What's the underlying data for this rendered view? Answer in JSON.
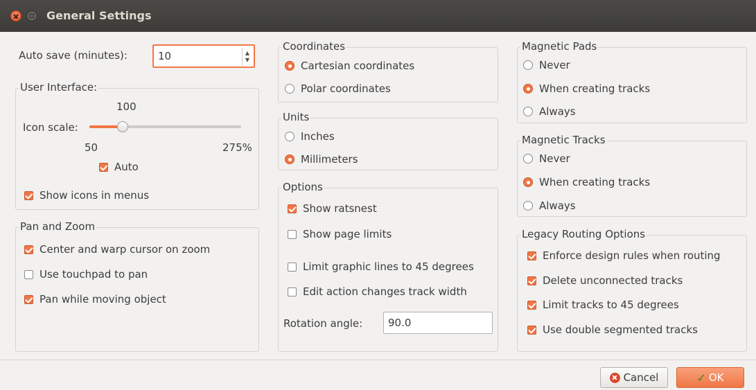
{
  "window": {
    "title": "General Settings"
  },
  "autosave": {
    "label": "Auto save (minutes):",
    "value": "10"
  },
  "user_interface": {
    "title": "User Interface:",
    "icon_scale_label": "Icon scale:",
    "icon_scale_value": "100",
    "slider_min": "50",
    "slider_max": "275%",
    "slider_fraction": 0.22,
    "auto": {
      "label": "Auto",
      "checked": true
    },
    "show_icons": {
      "label": "Show icons in menus",
      "checked": true
    }
  },
  "pan_zoom": {
    "title": "Pan and Zoom",
    "items": [
      {
        "label": "Center and warp cursor on zoom",
        "checked": true
      },
      {
        "label": "Use touchpad to pan",
        "checked": false
      },
      {
        "label": "Pan while moving object",
        "checked": true
      }
    ]
  },
  "coordinates": {
    "title": "Coordinates",
    "options": [
      {
        "label": "Cartesian coordinates",
        "selected": true
      },
      {
        "label": "Polar coordinates",
        "selected": false
      }
    ]
  },
  "units": {
    "title": "Units",
    "options": [
      {
        "label": "Inches",
        "selected": false
      },
      {
        "label": "Millimeters",
        "selected": true
      }
    ]
  },
  "options": {
    "title": "Options",
    "items": [
      {
        "label": "Show ratsnest",
        "checked": true
      },
      {
        "label": "Show page limits",
        "checked": false
      },
      {
        "label": "Limit graphic lines to 45 degrees",
        "checked": false
      },
      {
        "label": "Edit action changes track width",
        "checked": false
      }
    ],
    "rotation_label": "Rotation angle:",
    "rotation_value": "90.0"
  },
  "magnetic_pads": {
    "title": "Magnetic Pads",
    "options": [
      {
        "label": "Never",
        "selected": false
      },
      {
        "label": "When creating tracks",
        "selected": true
      },
      {
        "label": "Always",
        "selected": false
      }
    ]
  },
  "magnetic_tracks": {
    "title": "Magnetic Tracks",
    "options": [
      {
        "label": "Never",
        "selected": false
      },
      {
        "label": "When creating tracks",
        "selected": true
      },
      {
        "label": "Always",
        "selected": false
      }
    ]
  },
  "legacy_routing": {
    "title": "Legacy Routing Options",
    "items": [
      {
        "label": "Enforce design rules when routing",
        "checked": true
      },
      {
        "label": "Delete unconnected tracks",
        "checked": true
      },
      {
        "label": "Limit tracks to 45 degrees",
        "checked": true
      },
      {
        "label": "Use double segmented tracks",
        "checked": true
      }
    ]
  },
  "buttons": {
    "cancel": "Cancel",
    "ok": "OK"
  },
  "icons": {
    "close": "close-icon",
    "minimize": "minimize-icon",
    "cancel": "cancel-icon",
    "ok": "checkmark-icon"
  },
  "colors": {
    "accent": "#f07746",
    "titlebar": "#3c3b37"
  }
}
